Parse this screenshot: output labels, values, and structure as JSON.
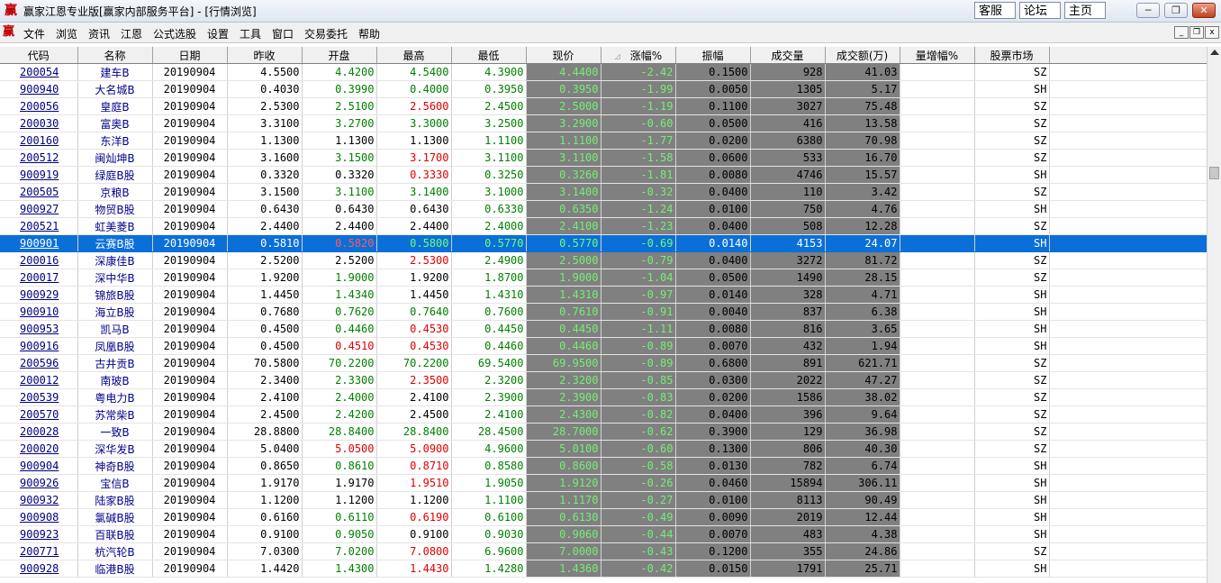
{
  "window": {
    "icon_glyph": "赢",
    "title": "赢家江恩专业版[赢家内部服务平台] - [行情浏览]",
    "links": [
      "客服",
      "论坛",
      "主页"
    ],
    "controls": [
      "─",
      "❐",
      "✕"
    ]
  },
  "menu": {
    "icon_glyph": "赢",
    "items": [
      "文件",
      "浏览",
      "资讯",
      "江恩",
      "公式选股",
      "设置",
      "工具",
      "窗口",
      "交易委托",
      "帮助"
    ],
    "mdi_controls": [
      "_",
      "❐",
      "x"
    ]
  },
  "table": {
    "headers": [
      "代码",
      "名称",
      "日期",
      "昨收",
      "开盘",
      "最高",
      "最低",
      "现价",
      "涨幅%",
      "振幅",
      "成交量",
      "成交额(万)",
      "量增幅%",
      "股票市场",
      ""
    ],
    "sort_icon": "sort-indicator-icon",
    "selected_index": 10,
    "rows": [
      [
        "200054",
        "建车B",
        "20190904",
        "4.5500",
        "4.4200",
        "4.5400",
        "4.3900",
        "4.4400",
        "-2.42",
        "0.1500",
        "928",
        "41.03",
        "",
        "SZ"
      ],
      [
        "900940",
        "大名城B",
        "20190904",
        "0.4030",
        "0.3990",
        "0.4000",
        "0.3950",
        "0.3950",
        "-1.99",
        "0.0050",
        "1305",
        "5.17",
        "",
        "SH"
      ],
      [
        "200056",
        "皇庭B",
        "20190904",
        "2.5300",
        "2.5100",
        "2.5600",
        "2.4500",
        "2.5000",
        "-1.19",
        "0.1100",
        "3027",
        "75.48",
        "",
        "SZ"
      ],
      [
        "200030",
        "富奥B",
        "20190904",
        "3.3100",
        "3.2700",
        "3.3000",
        "3.2500",
        "3.2900",
        "-0.60",
        "0.0500",
        "416",
        "13.58",
        "",
        "SZ"
      ],
      [
        "200160",
        "东洋B",
        "20190904",
        "1.1300",
        "1.1300",
        "1.1300",
        "1.1100",
        "1.1100",
        "-1.77",
        "0.0200",
        "6380",
        "70.98",
        "",
        "SZ"
      ],
      [
        "200512",
        "闽灿坤B",
        "20190904",
        "3.1600",
        "3.1500",
        "3.1700",
        "3.1100",
        "3.1100",
        "-1.58",
        "0.0600",
        "533",
        "16.70",
        "",
        "SZ"
      ],
      [
        "900919",
        "绿庭B股",
        "20190904",
        "0.3320",
        "0.3320",
        "0.3330",
        "0.3250",
        "0.3260",
        "-1.81",
        "0.0080",
        "4746",
        "15.57",
        "",
        "SH"
      ],
      [
        "200505",
        "京粮B",
        "20190904",
        "3.1500",
        "3.1100",
        "3.1400",
        "3.1000",
        "3.1400",
        "-0.32",
        "0.0400",
        "110",
        "3.42",
        "",
        "SZ"
      ],
      [
        "900927",
        "物贸B股",
        "20190904",
        "0.6430",
        "0.6430",
        "0.6430",
        "0.6330",
        "0.6350",
        "-1.24",
        "0.0100",
        "750",
        "4.76",
        "",
        "SH"
      ],
      [
        "200521",
        "虹美菱B",
        "20190904",
        "2.4400",
        "2.4400",
        "2.4400",
        "2.4000",
        "2.4100",
        "-1.23",
        "0.0400",
        "508",
        "12.28",
        "",
        "SZ"
      ],
      [
        "900901",
        "云赛B股",
        "20190904",
        "0.5810",
        "0.5820",
        "0.5800",
        "0.5770",
        "0.5770",
        "-0.69",
        "0.0140",
        "4153",
        "24.07",
        "",
        "SH"
      ],
      [
        "200016",
        "深康佳B",
        "20190904",
        "2.5200",
        "2.5200",
        "2.5300",
        "2.4900",
        "2.5000",
        "-0.79",
        "0.0400",
        "3272",
        "81.72",
        "",
        "SZ"
      ],
      [
        "200017",
        "深中华B",
        "20190904",
        "1.9200",
        "1.9000",
        "1.9200",
        "1.8700",
        "1.9000",
        "-1.04",
        "0.0500",
        "1490",
        "28.15",
        "",
        "SZ"
      ],
      [
        "900929",
        "锦旅B股",
        "20190904",
        "1.4450",
        "1.4340",
        "1.4450",
        "1.4310",
        "1.4310",
        "-0.97",
        "0.0140",
        "328",
        "4.71",
        "",
        "SH"
      ],
      [
        "900910",
        "海立B股",
        "20190904",
        "0.7680",
        "0.7620",
        "0.7640",
        "0.7600",
        "0.7610",
        "-0.91",
        "0.0040",
        "837",
        "6.38",
        "",
        "SH"
      ],
      [
        "900953",
        "凯马B",
        "20190904",
        "0.4500",
        "0.4460",
        "0.4530",
        "0.4450",
        "0.4450",
        "-1.11",
        "0.0080",
        "816",
        "3.65",
        "",
        "SH"
      ],
      [
        "900916",
        "凤凰B股",
        "20190904",
        "0.4500",
        "0.4510",
        "0.4530",
        "0.4460",
        "0.4460",
        "-0.89",
        "0.0070",
        "432",
        "1.94",
        "",
        "SH"
      ],
      [
        "200596",
        "古井贡B",
        "20190904",
        "70.5800",
        "70.2200",
        "70.2200",
        "69.5400",
        "69.9500",
        "-0.89",
        "0.6800",
        "891",
        "621.71",
        "",
        "SZ"
      ],
      [
        "200012",
        "南玻B",
        "20190904",
        "2.3400",
        "2.3300",
        "2.3500",
        "2.3200",
        "2.3200",
        "-0.85",
        "0.0300",
        "2022",
        "47.27",
        "",
        "SZ"
      ],
      [
        "200539",
        "粤电力B",
        "20190904",
        "2.4100",
        "2.4000",
        "2.4100",
        "2.3900",
        "2.3900",
        "-0.83",
        "0.0200",
        "1586",
        "38.02",
        "",
        "SZ"
      ],
      [
        "200570",
        "苏常柴B",
        "20190904",
        "2.4500",
        "2.4200",
        "2.4500",
        "2.4100",
        "2.4300",
        "-0.82",
        "0.0400",
        "396",
        "9.64",
        "",
        "SZ"
      ],
      [
        "200028",
        "一致B",
        "20190904",
        "28.8800",
        "28.8400",
        "28.8400",
        "28.4500",
        "28.7000",
        "-0.62",
        "0.3900",
        "129",
        "36.98",
        "",
        "SZ"
      ],
      [
        "200020",
        "深华发B",
        "20190904",
        "5.0400",
        "5.0500",
        "5.0900",
        "4.9600",
        "5.0100",
        "-0.60",
        "0.1300",
        "806",
        "40.30",
        "",
        "SZ"
      ],
      [
        "900904",
        "神奇B股",
        "20190904",
        "0.8650",
        "0.8610",
        "0.8710",
        "0.8580",
        "0.8600",
        "-0.58",
        "0.0130",
        "782",
        "6.74",
        "",
        "SH"
      ],
      [
        "900926",
        "宝信B",
        "20190904",
        "1.9170",
        "1.9170",
        "1.9510",
        "1.9050",
        "1.9120",
        "-0.26",
        "0.0460",
        "15894",
        "306.11",
        "",
        "SH"
      ],
      [
        "900932",
        "陆家B股",
        "20190904",
        "1.1200",
        "1.1200",
        "1.1200",
        "1.1100",
        "1.1170",
        "-0.27",
        "0.0100",
        "8113",
        "90.49",
        "",
        "SH"
      ],
      [
        "900908",
        "氯碱B股",
        "20190904",
        "0.6160",
        "0.6110",
        "0.6190",
        "0.6100",
        "0.6130",
        "-0.49",
        "0.0090",
        "2019",
        "12.44",
        "",
        "SH"
      ],
      [
        "900923",
        "百联B股",
        "20190904",
        "0.9100",
        "0.9050",
        "0.9100",
        "0.9030",
        "0.9060",
        "-0.44",
        "0.0070",
        "483",
        "4.38",
        "",
        "SH"
      ],
      [
        "200771",
        "杭汽轮B",
        "20190904",
        "7.0300",
        "7.0200",
        "7.0800",
        "6.9600",
        "7.0000",
        "-0.43",
        "0.1200",
        "355",
        "24.86",
        "",
        "SZ"
      ],
      [
        "900928",
        "临港B股",
        "20190904",
        "1.4420",
        "1.4300",
        "1.4430",
        "1.4280",
        "1.4360",
        "-0.42",
        "0.0150",
        "1791",
        "25.71",
        "",
        "SH"
      ]
    ]
  },
  "colors": {
    "up": "#e00000",
    "down": "#008000",
    "dark_col": "#808080",
    "selection": "#0a6fd8"
  }
}
